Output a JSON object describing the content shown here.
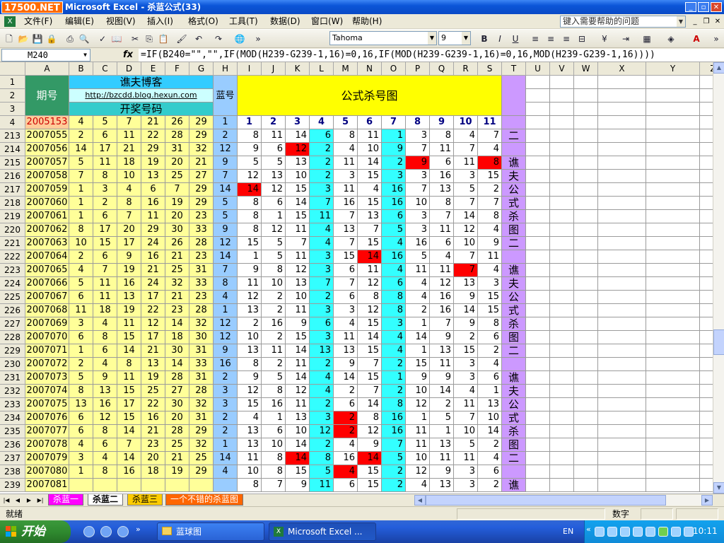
{
  "window": {
    "title": "Microsoft Excel - 杀蓝公式(33)",
    "logo": "17500.NET"
  },
  "menu": {
    "items": [
      "文件(F)",
      "编辑(E)",
      "视图(V)",
      "插入(I)",
      "格式(O)",
      "工具(T)",
      "数据(D)",
      "窗口(W)",
      "帮助(H)"
    ],
    "help_placeholder": "键入需要帮助的问题"
  },
  "toolbar": {
    "font": "Tahoma",
    "size": "9"
  },
  "formula_bar": {
    "name_box": "M240",
    "formula": "=IF(B240=\"\",\"\",IF(MOD(H239-G239-1,16)=0,16,IF(MOD(H239-G239-1,16)=0,16,MOD(H239-G239-1,16))))"
  },
  "columns": [
    "A",
    "B",
    "C",
    "D",
    "E",
    "F",
    "G",
    "H",
    "I",
    "J",
    "K",
    "L",
    "M",
    "N",
    "O",
    "P",
    "Q",
    "R",
    "S",
    "T",
    "U",
    "V",
    "W",
    "X",
    "Y",
    "Z"
  ],
  "header": {
    "period_label": "期号",
    "blog_title": "谯夫博客",
    "blog_url": "http://bzcdd.blog.hexun.com",
    "draw_label": "开奖号码",
    "blue_label": "蓝号",
    "chart_title": "公式杀号图",
    "numbers": [
      "1",
      "2",
      "3",
      "4",
      "5",
      "6",
      "7",
      "8",
      "9",
      "10",
      "11"
    ]
  },
  "first_row": {
    "period": "2005153",
    "reds": [
      "4",
      "5",
      "7",
      "21",
      "26",
      "29"
    ],
    "blue": "1"
  },
  "side_chars": [
    "二",
    "",
    "谯",
    "夫",
    "公",
    "式",
    "杀",
    "图",
    "二",
    "",
    "谯",
    "夫",
    "公",
    "式",
    "杀",
    "图",
    "二",
    "",
    "谯",
    "夫",
    "公",
    "式",
    "杀",
    "图",
    "二",
    "",
    "谯"
  ],
  "rows": [
    {
      "n": "213",
      "p": "2007055",
      "r": [
        "2",
        "6",
        "11",
        "22",
        "28",
        "29"
      ],
      "b": "2",
      "k": [
        "8",
        "11",
        "14",
        "6",
        "8",
        "11",
        "1",
        "3",
        "8",
        "4",
        "7"
      ]
    },
    {
      "n": "214",
      "p": "2007056",
      "r": [
        "14",
        "17",
        "21",
        "29",
        "31",
        "32"
      ],
      "b": "12",
      "k": [
        "9",
        "6",
        "12",
        "2",
        "4",
        "10",
        "9",
        "7",
        "11",
        "7",
        "4"
      ]
    },
    {
      "n": "215",
      "p": "2007057",
      "r": [
        "5",
        "11",
        "18",
        "19",
        "20",
        "21"
      ],
      "b": "9",
      "k": [
        "5",
        "5",
        "13",
        "2",
        "11",
        "14",
        "2",
        "9",
        "6",
        "11",
        "8"
      ]
    },
    {
      "n": "216",
      "p": "2007058",
      "r": [
        "7",
        "8",
        "10",
        "13",
        "25",
        "27"
      ],
      "b": "7",
      "k": [
        "12",
        "13",
        "10",
        "2",
        "3",
        "15",
        "3",
        "3",
        "16",
        "3",
        "15"
      ]
    },
    {
      "n": "217",
      "p": "2007059",
      "r": [
        "1",
        "3",
        "4",
        "6",
        "7",
        "29"
      ],
      "b": "14",
      "k": [
        "14",
        "12",
        "15",
        "3",
        "11",
        "4",
        "16",
        "7",
        "13",
        "5",
        "2"
      ]
    },
    {
      "n": "218",
      "p": "2007060",
      "r": [
        "1",
        "2",
        "8",
        "16",
        "19",
        "29"
      ],
      "b": "5",
      "k": [
        "8",
        "6",
        "14",
        "7",
        "16",
        "15",
        "16",
        "10",
        "8",
        "7",
        "7"
      ]
    },
    {
      "n": "219",
      "p": "2007061",
      "r": [
        "1",
        "6",
        "7",
        "11",
        "20",
        "23"
      ],
      "b": "5",
      "k": [
        "8",
        "1",
        "15",
        "11",
        "7",
        "13",
        "6",
        "3",
        "7",
        "14",
        "8"
      ]
    },
    {
      "n": "220",
      "p": "2007062",
      "r": [
        "8",
        "17",
        "20",
        "29",
        "30",
        "33"
      ],
      "b": "9",
      "k": [
        "8",
        "12",
        "11",
        "4",
        "13",
        "7",
        "5",
        "3",
        "11",
        "12",
        "4"
      ]
    },
    {
      "n": "221",
      "p": "2007063",
      "r": [
        "10",
        "15",
        "17",
        "24",
        "26",
        "28"
      ],
      "b": "12",
      "k": [
        "15",
        "5",
        "7",
        "4",
        "7",
        "15",
        "4",
        "16",
        "6",
        "10",
        "9"
      ]
    },
    {
      "n": "222",
      "p": "2007064",
      "r": [
        "2",
        "6",
        "9",
        "16",
        "21",
        "23"
      ],
      "b": "14",
      "k": [
        "1",
        "5",
        "11",
        "3",
        "15",
        "14",
        "16",
        "5",
        "4",
        "7",
        "11"
      ]
    },
    {
      "n": "223",
      "p": "2007065",
      "r": [
        "4",
        "7",
        "19",
        "21",
        "25",
        "31"
      ],
      "b": "7",
      "k": [
        "9",
        "8",
        "12",
        "3",
        "6",
        "11",
        "4",
        "11",
        "11",
        "7",
        "4"
      ]
    },
    {
      "n": "224",
      "p": "2007066",
      "r": [
        "5",
        "11",
        "16",
        "24",
        "32",
        "33"
      ],
      "b": "8",
      "k": [
        "11",
        "10",
        "13",
        "7",
        "7",
        "12",
        "6",
        "4",
        "12",
        "13",
        "3"
      ]
    },
    {
      "n": "225",
      "p": "2007067",
      "r": [
        "6",
        "11",
        "13",
        "17",
        "21",
        "23"
      ],
      "b": "4",
      "k": [
        "12",
        "2",
        "10",
        "2",
        "6",
        "8",
        "8",
        "4",
        "16",
        "9",
        "15"
      ]
    },
    {
      "n": "226",
      "p": "2007068",
      "r": [
        "11",
        "18",
        "19",
        "22",
        "23",
        "28"
      ],
      "b": "1",
      "k": [
        "13",
        "2",
        "11",
        "3",
        "3",
        "12",
        "8",
        "2",
        "16",
        "14",
        "15"
      ]
    },
    {
      "n": "227",
      "p": "2007069",
      "r": [
        "3",
        "4",
        "11",
        "12",
        "14",
        "32"
      ],
      "b": "12",
      "k": [
        "2",
        "16",
        "9",
        "6",
        "4",
        "15",
        "3",
        "1",
        "7",
        "9",
        "8"
      ]
    },
    {
      "n": "228",
      "p": "2007070",
      "r": [
        "6",
        "8",
        "15",
        "17",
        "18",
        "30"
      ],
      "b": "12",
      "k": [
        "10",
        "2",
        "15",
        "3",
        "11",
        "14",
        "4",
        "14",
        "9",
        "2",
        "6"
      ]
    },
    {
      "n": "229",
      "p": "2007071",
      "r": [
        "1",
        "6",
        "14",
        "21",
        "30",
        "31"
      ],
      "b": "9",
      "k": [
        "13",
        "11",
        "14",
        "13",
        "13",
        "15",
        "4",
        "1",
        "13",
        "15",
        "2"
      ]
    },
    {
      "n": "230",
      "p": "2007072",
      "r": [
        "2",
        "4",
        "8",
        "13",
        "14",
        "33"
      ],
      "b": "16",
      "k": [
        "8",
        "2",
        "11",
        "2",
        "9",
        "7",
        "2",
        "15",
        "11",
        "3",
        "4"
      ]
    },
    {
      "n": "231",
      "p": "2007073",
      "r": [
        "5",
        "9",
        "11",
        "19",
        "28",
        "31"
      ],
      "b": "2",
      "k": [
        "9",
        "5",
        "14",
        "4",
        "14",
        "15",
        "1",
        "9",
        "9",
        "3",
        "6"
      ]
    },
    {
      "n": "232",
      "p": "2007074",
      "r": [
        "8",
        "13",
        "15",
        "25",
        "27",
        "28"
      ],
      "b": "3",
      "k": [
        "12",
        "8",
        "12",
        "4",
        "2",
        "7",
        "2",
        "10",
        "14",
        "4",
        "1"
      ]
    },
    {
      "n": "233",
      "p": "2007075",
      "r": [
        "13",
        "16",
        "17",
        "22",
        "30",
        "32"
      ],
      "b": "3",
      "k": [
        "15",
        "16",
        "11",
        "2",
        "6",
        "14",
        "8",
        "12",
        "2",
        "11",
        "13"
      ]
    },
    {
      "n": "234",
      "p": "2007076",
      "r": [
        "6",
        "12",
        "15",
        "16",
        "20",
        "31"
      ],
      "b": "2",
      "k": [
        "4",
        "1",
        "13",
        "3",
        "2",
        "8",
        "16",
        "1",
        "5",
        "7",
        "10"
      ]
    },
    {
      "n": "235",
      "p": "2007077",
      "r": [
        "6",
        "8",
        "14",
        "21",
        "28",
        "29"
      ],
      "b": "2",
      "k": [
        "13",
        "6",
        "10",
        "12",
        "2",
        "12",
        "16",
        "11",
        "1",
        "10",
        "14"
      ]
    },
    {
      "n": "236",
      "p": "2007078",
      "r": [
        "4",
        "6",
        "7",
        "23",
        "25",
        "32"
      ],
      "b": "1",
      "k": [
        "13",
        "10",
        "14",
        "2",
        "4",
        "9",
        "7",
        "11",
        "13",
        "5",
        "2"
      ]
    },
    {
      "n": "237",
      "p": "2007079",
      "r": [
        "3",
        "4",
        "14",
        "20",
        "21",
        "25"
      ],
      "b": "14",
      "k": [
        "11",
        "8",
        "14",
        "8",
        "16",
        "14",
        "5",
        "10",
        "11",
        "11",
        "4"
      ]
    },
    {
      "n": "238",
      "p": "2007080",
      "r": [
        "1",
        "8",
        "16",
        "18",
        "19",
        "29"
      ],
      "b": "4",
      "k": [
        "10",
        "8",
        "15",
        "5",
        "4",
        "15",
        "2",
        "12",
        "9",
        "3",
        "6"
      ]
    },
    {
      "n": "239",
      "p": "2007081",
      "r": [
        "",
        "",
        "",
        "",
        "",
        ""
      ],
      "b": "",
      "k": [
        "8",
        "7",
        "9",
        "11",
        "6",
        "15",
        "2",
        "4",
        "13",
        "3",
        "2"
      ]
    }
  ],
  "highlights": [
    [
      1,
      2
    ],
    [
      2,
      7
    ],
    [
      2,
      10
    ],
    [
      4,
      0
    ],
    [
      9,
      5
    ],
    [
      10,
      9
    ],
    [
      21,
      4
    ],
    [
      22,
      4
    ],
    [
      24,
      2
    ],
    [
      24,
      5
    ],
    [
      25,
      4
    ]
  ],
  "sheets": [
    "杀蓝一",
    "杀蓝二",
    "杀蓝三",
    "一个不错的杀蓝图"
  ],
  "status": {
    "ready": "就绪",
    "mode": "数字"
  },
  "taskbar": {
    "start": "开始",
    "tasks": [
      "蓝球图",
      "Microsoft Excel ..."
    ],
    "lang": "EN",
    "time": "10:11"
  },
  "colors": {
    "yellow_cells": "#ffff99",
    "bright_yellow": "#ffff00",
    "cyan": "#33ffff",
    "light_blue": "#99ccff",
    "lavender": "#cc99ff",
    "highlight_red": "#ff0000",
    "green_header": "#339966",
    "period_pink": "#ffcc99",
    "teal_header": "#33cccc"
  }
}
